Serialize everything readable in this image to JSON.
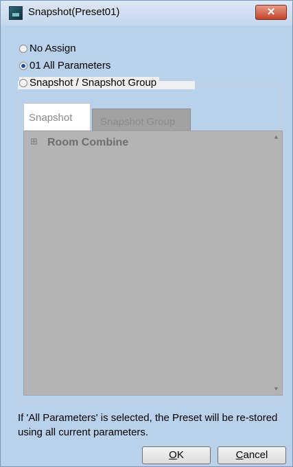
{
  "window": {
    "title": "Snapshot(Preset01)",
    "close_glyph": "✕",
    "icon": "app-icon"
  },
  "options": {
    "no_assign": "No Assign",
    "all_parameters": "01 All Parameters",
    "snapshot": "Snapshot / Snapshot Group",
    "selected": "all_parameters"
  },
  "tabs": {
    "snapshot": "Snapshot",
    "snapshot_group": "Snapshot Group",
    "active": "snapshot"
  },
  "tree": {
    "expand_glyph": "⊞",
    "items": [
      {
        "label": "Room Combine"
      }
    ],
    "scroll_up": "▲",
    "scroll_down": "▼"
  },
  "info": {
    "text": "If 'All Parameters' is selected, the Preset will be re-stored using all current parameters."
  },
  "buttons": {
    "ok_accel": "O",
    "ok_rest": "K",
    "cancel_accel": "C",
    "cancel_rest": "ancel"
  }
}
